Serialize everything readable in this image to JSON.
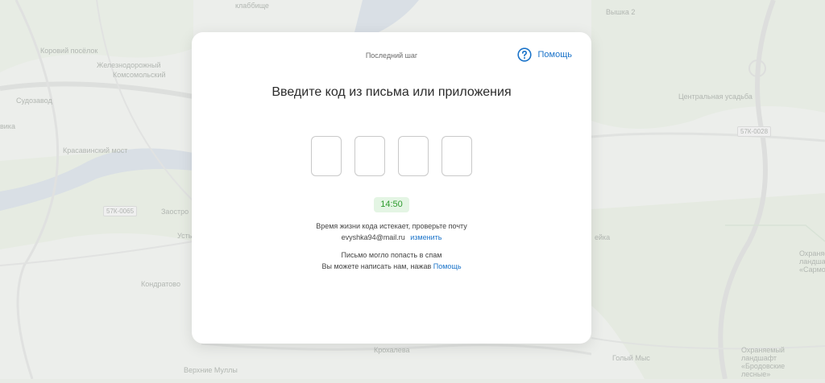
{
  "map": {
    "labels": [
      "клаббище",
      "Вышка 2",
      "Коровий посёлок",
      "Железнодорожный",
      "Комсомольский",
      "Судозавод",
      "Центральная усадьба",
      "Красавинский мост",
      "Заостро",
      "Усть",
      "Кондратово",
      "Крохалева",
      "Голый Мыс",
      "Верхние Муллы",
      "Охраняемый ландшафт «Сармос»",
      "Охраняемый ландшафт «Бродовские лесные»",
      "ейка",
      "вика"
    ],
    "road_labels": [
      "57К-0028",
      "57К-0065"
    ]
  },
  "modal": {
    "step": "Последний шаг",
    "help_label": "Помощь",
    "help_icon": "question-circle-icon",
    "title": "Введите код из письма или приложения",
    "code_placeholders": [
      "",
      "",
      "",
      ""
    ],
    "timer": "14:50",
    "expire_text": "Время жизни кода истекает, проверьте почту",
    "email": "evyshka94@mail.ru",
    "change_label": "изменить",
    "spam_text": "Письмо могло попасть в спам",
    "write_text": "Вы можете написать нам, нажав",
    "write_link": "Помощь"
  },
  "colors": {
    "accent": "#1a73c9",
    "timer_bg": "#e4f5e4",
    "timer_text": "#2e9b2e"
  }
}
